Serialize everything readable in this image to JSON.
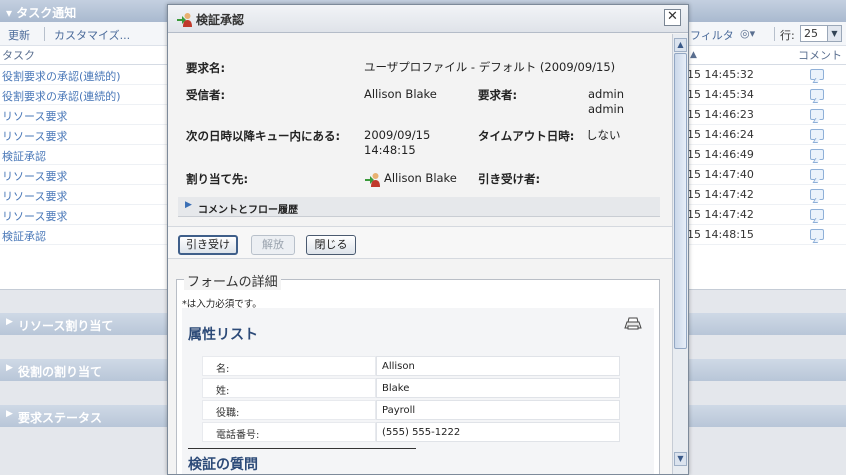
{
  "portal": {
    "header_title": "タスク通知",
    "toolbar": {
      "refresh": "更新",
      "customize": "カスタマイズ...",
      "filter": "フィルタ",
      "rows_label": "行:",
      "rows_value": "25"
    },
    "columns": {
      "task": "タスク",
      "comment": "コメント"
    },
    "tasks": [
      {
        "name": "役割要求の承認(連続的)",
        "date": "15 14:45:32"
      },
      {
        "name": "役割要求の承認(連続的)",
        "date": "15 14:45:34"
      },
      {
        "name": "リソース要求",
        "date": "15 14:46:23"
      },
      {
        "name": "リソース要求",
        "date": "15 14:46:24"
      },
      {
        "name": "検証承認",
        "date": "15 14:46:49"
      },
      {
        "name": "リソース要求",
        "date": "15 14:47:40"
      },
      {
        "name": "リソース要求",
        "date": "15 14:47:42"
      },
      {
        "name": "リソース要求",
        "date": "15 14:47:42"
      },
      {
        "name": "検証承認",
        "date": "15 14:48:15"
      }
    ],
    "sections": [
      "リソース割り当て",
      "役割の割り当て",
      "要求ステータス"
    ]
  },
  "modal": {
    "title": "検証承認",
    "close_glyph": "✕",
    "request_name_label": "要求名:",
    "request_name_value": "ユーザプロファイル - デフォルト (2009/09/15)",
    "recipient_label": "受信者:",
    "recipient_value": "Allison Blake",
    "requester_label": "要求者:",
    "requester_value_1": "admin",
    "requester_value_2": "admin",
    "queued_label": "次の日時以降キュー内にある:",
    "queued_value_1": "2009/09/15",
    "queued_value_2": "14:48:15",
    "timeout_label": "タイムアウト日時:",
    "timeout_value": "しない",
    "assigned_label": "割り当て先:",
    "assigned_value": "Allison Blake",
    "claimed_label": "引き受け者:",
    "history_label": "コメントとフロー履歴",
    "buttons": {
      "claim": "引き受け",
      "release": "解放",
      "close": "閉じる"
    },
    "form_legend": "フォームの詳細",
    "required_note": "*は入力必須です。",
    "attr_title": "属性リスト",
    "attributes": [
      {
        "label": "名:",
        "value": "Allison"
      },
      {
        "label": "姓:",
        "value": "Blake"
      },
      {
        "label": "役職:",
        "value": "Payroll"
      },
      {
        "label": "電話番号:",
        "value": "(555) 555-1222"
      }
    ],
    "verify_title": "検証の質問"
  }
}
